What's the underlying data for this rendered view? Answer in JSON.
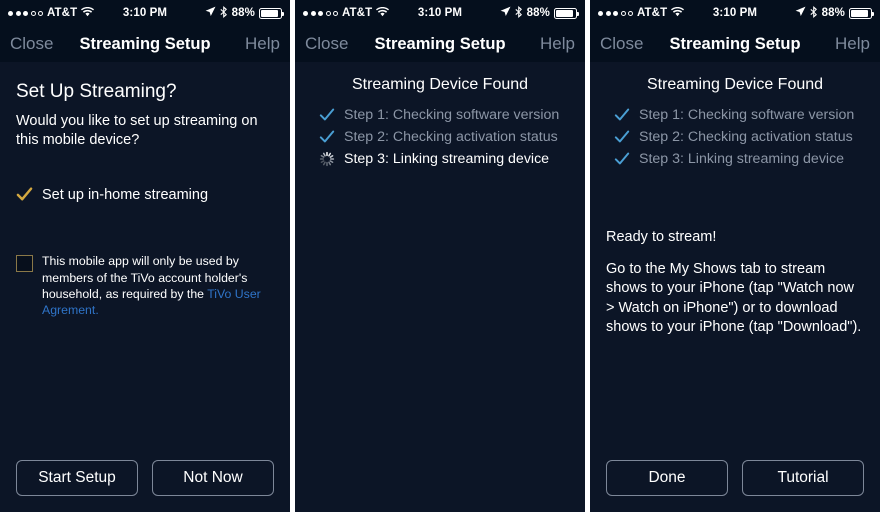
{
  "statusbar": {
    "signal_dots_filled": 3,
    "signal_dots_hollow": 2,
    "carrier": "AT&T",
    "wifi_icon": "wifi-icon",
    "time": "3:10 PM",
    "location_icon": "location-arrow-icon",
    "bluetooth_icon": "bluetooth-icon",
    "battery_percent": "88%",
    "battery_icon": "battery-icon"
  },
  "navbar": {
    "close_label": "Close",
    "title": "Streaming Setup",
    "help_label": "Help"
  },
  "colors": {
    "background": "#0c1526",
    "navbar_background": "#050f1d",
    "gold_check": "#d4a840",
    "blue_check": "#4a9fd4",
    "link": "#2f74c8",
    "muted_text": "#8c96a6",
    "nav_side_text": "#7e8a9c",
    "checkbox_border": "#8a7848",
    "button_border": "#7d8798"
  },
  "panel1": {
    "heading": "Set Up Streaming?",
    "body": "Would you like to set up streaming on this mobile device?",
    "option_check_icon": "check-icon",
    "option_label": "Set up in-home streaming",
    "checkbox_checked": false,
    "disclaimer_text_1": "This mobile app will only be used by members of the TiVo account holder's household, as required by the ",
    "disclaimer_link": "TiVo User Agrement.",
    "buttons": [
      {
        "label": "Start Setup",
        "name": "start-setup-button"
      },
      {
        "label": "Not Now",
        "name": "not-now-button"
      }
    ]
  },
  "panel2": {
    "heading": "Streaming Device Found",
    "steps": [
      {
        "label": "Step 1: Checking software version",
        "state": "done",
        "icon": "check-icon"
      },
      {
        "label": "Step 2: Checking activation status",
        "state": "done",
        "icon": "check-icon"
      },
      {
        "label": "Step 3: Linking streaming device",
        "state": "loading",
        "icon": "spinner-icon"
      }
    ]
  },
  "panel3": {
    "heading": "Streaming Device Found",
    "steps": [
      {
        "label": "Step 1: Checking software version",
        "state": "done",
        "icon": "check-icon"
      },
      {
        "label": "Step 2: Checking activation status",
        "state": "done",
        "icon": "check-icon"
      },
      {
        "label": "Step 3: Linking streaming device",
        "state": "done",
        "icon": "check-icon"
      }
    ],
    "ready_title": "Ready to stream!",
    "ready_body": "Go to the My Shows tab to stream shows to your iPhone (tap \"Watch now > Watch on iPhone\") or to download shows to your iPhone (tap \"Download\").",
    "buttons": [
      {
        "label": "Done",
        "name": "done-button"
      },
      {
        "label": "Tutorial",
        "name": "tutorial-button"
      }
    ]
  }
}
